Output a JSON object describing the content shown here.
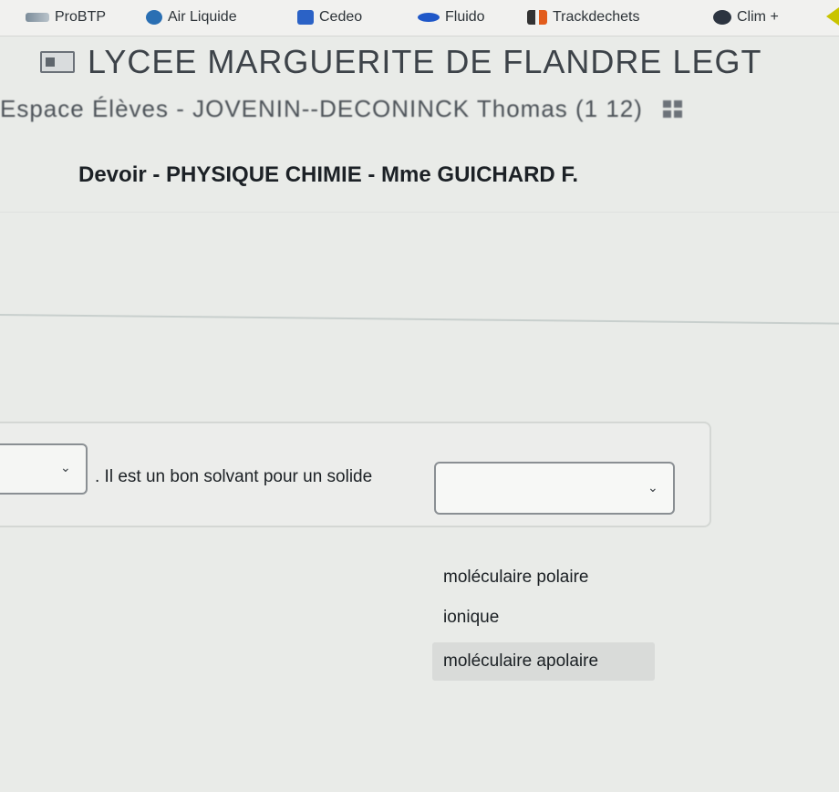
{
  "bookmarks": [
    {
      "label": "ProBTP",
      "icon": "probtp-icon"
    },
    {
      "label": "Air Liquide",
      "icon": "air-liquide-icon"
    },
    {
      "label": "Cedeo",
      "icon": "cedeo-icon"
    },
    {
      "label": "Fluido",
      "icon": "fluido-icon"
    },
    {
      "label": "Trackdechets",
      "icon": "trackdechets-icon"
    },
    {
      "label": "Clim +",
      "icon": "clim-icon"
    }
  ],
  "school": {
    "name": "LYCEE MARGUERITE DE FLANDRE LEGT"
  },
  "space": {
    "label": "Espace Élèves - JOVENIN--DECONINCK Thomas (1 12)"
  },
  "devoir": {
    "title": "Devoir - PHYSIQUE CHIMIE - Mme GUICHARD F."
  },
  "question": {
    "text": ". Il est un bon solvant pour un solide",
    "left_select_value": "",
    "right_select_value": "",
    "options": [
      "moléculaire polaire",
      "ionique",
      "moléculaire apolaire"
    ],
    "highlighted_option": "moléculaire apolaire"
  },
  "colors": {
    "background": "#e9ebe8",
    "highlight": "#d9dbd9",
    "border": "#8a8f93"
  }
}
